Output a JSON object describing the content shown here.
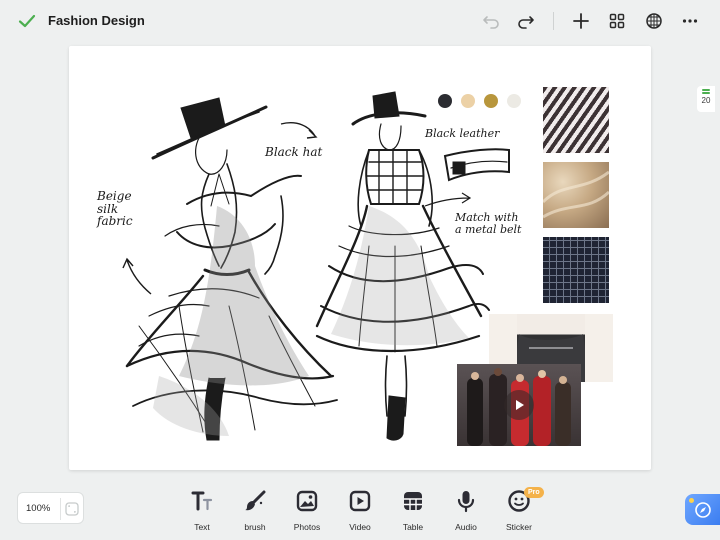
{
  "header": {
    "title": "Fashion Design",
    "icons": [
      "checkmark-icon",
      "undo-icon",
      "redo-icon",
      "add-icon",
      "grid-icon",
      "globe-grid-icon",
      "more-icon"
    ]
  },
  "canvas": {
    "annotations": {
      "black_hat": "Black hat",
      "black_leather": "Black leather",
      "beige_line1": "Beige",
      "beige_line2": "silk",
      "beige_line3": "fabric",
      "belt_line1": "Match with",
      "belt_line2": "a metal belt"
    },
    "palette": [
      "#2b2c31",
      "#ecd1a6",
      "#b8963c",
      "#eceae4"
    ]
  },
  "pager": {
    "page_number": "20"
  },
  "zoom": {
    "value": "100%"
  },
  "toolbar": {
    "text": "Text",
    "brush": "brush",
    "photos": "Photos",
    "video": "Video",
    "table": "Table",
    "audio": "Audio",
    "sticker": "Sticker",
    "pro_badge": "Pro"
  },
  "colors": {
    "accent": "#4caf50",
    "ai_button": "#3b7df0",
    "pro_badge": "#f4b24a"
  }
}
